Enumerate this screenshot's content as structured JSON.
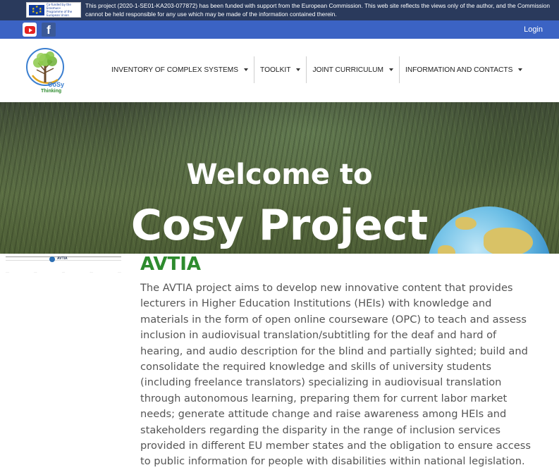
{
  "funding_notice": {
    "badge_text": "Co-funded by the Erasmus+ Programme of the European Union",
    "disclaimer": "This project (2020-1-SE01-KA203-077872) has been funded with support from the European Commission. This web site reflects the views only of the author, and the Commission cannot be held responsible for any use which may be made of the information contained therein."
  },
  "social": {
    "youtube_icon": "youtube-icon",
    "facebook_icon": "facebook-icon",
    "facebook_glyph": "f",
    "login_label": "Login"
  },
  "brand": {
    "logo_text_1": "CoSy",
    "logo_text_2": "Thinking"
  },
  "nav": {
    "items": [
      {
        "label": "INVENTORY OF COMPLEX SYSTEMS"
      },
      {
        "label": "TOOLKIT"
      },
      {
        "label": "JOINT CURRICULUM"
      },
      {
        "label": "INFORMATION AND CONTACTS"
      }
    ]
  },
  "hero": {
    "line1": "Welcome to",
    "line2": "Cosy Project"
  },
  "project": {
    "thumb_logo_text": "AVTIA",
    "heading": "AVTIA",
    "description": "The AVTIA project aims to develop new innovative content that provides lecturers in Higher Education Institutions (HEIs) with knowledge and materials in the form of open online courseware (OPC) to teach and assess inclusion in audiovisual translation/subtitling for the deaf and hard of hearing, and audio description for the blind and partially sighted; build and consolidate the required knowledge and skills of university students (including freelance translators) specializing in audiovisual translation through autonomous learning, preparing them for current labor market needs; generate attitude change and raise awareness among HEIs and stakeholders regarding the disparity in the range of inclusion services provided in different EU member states and the obligation to ensure access to public information for people with disabilities within national legislation."
  },
  "colors": {
    "topbar": "#2a3a5c",
    "socialbar": "#3b63c4",
    "heading_green": "#2e8b2e"
  }
}
